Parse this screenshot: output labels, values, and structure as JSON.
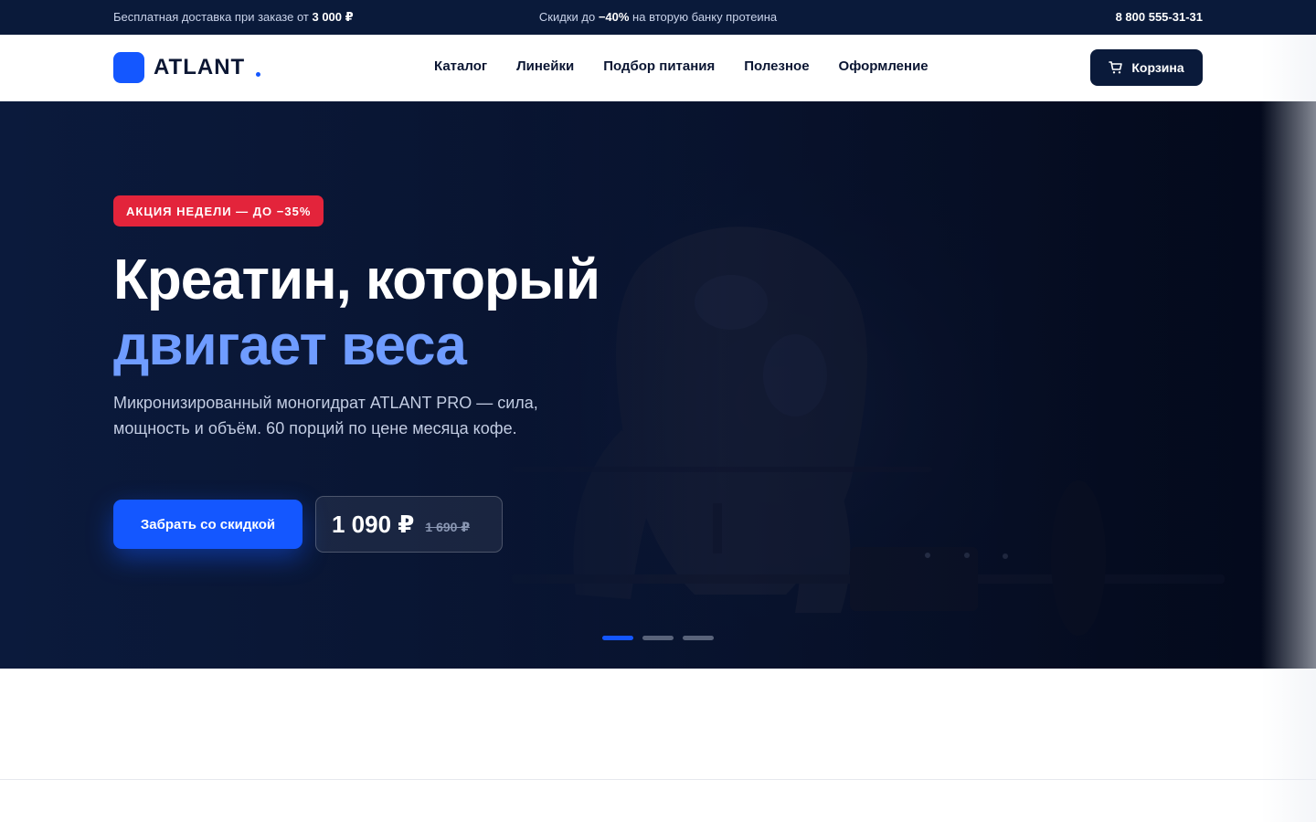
{
  "topbar": {
    "left_prefix": "Бесплатная доставка при заказе от ",
    "left_amount": "3 000 ₽",
    "center_prefix": "Скидки до ",
    "center_discount": "−40%",
    "center_suffix": " на вторую банку протеина",
    "phone": "8 800 555-31-31"
  },
  "header": {
    "logo_text": "ATLANT",
    "nav": [
      "Каталог",
      "Линейки",
      "Подбор питания",
      "Полезное",
      "Оформление"
    ],
    "cart_label": "Корзина"
  },
  "hero": {
    "badge": "АКЦИЯ НЕДЕЛИ — ДО −35%",
    "title_line1": "Креатин, который",
    "title_line2": "двигает веса",
    "description": "Микронизированный моногидрат ATLANT PRO — сила, мощность и объём. 60 порций по цене месяца кофе.",
    "cta_label": "Забрать со скидкой",
    "price_new": "1 090 ₽",
    "price_old": "1 690 ₽",
    "slides_total": 3,
    "slide_active": 1
  },
  "colors": {
    "brand_blue": "#1457ff",
    "navy": "#0a1a3a",
    "accent_light_blue": "#6f9cff",
    "sale_red": "#e3243b"
  },
  "icons": {
    "cart": "cart-icon",
    "logo": "logo-mark-icon"
  }
}
